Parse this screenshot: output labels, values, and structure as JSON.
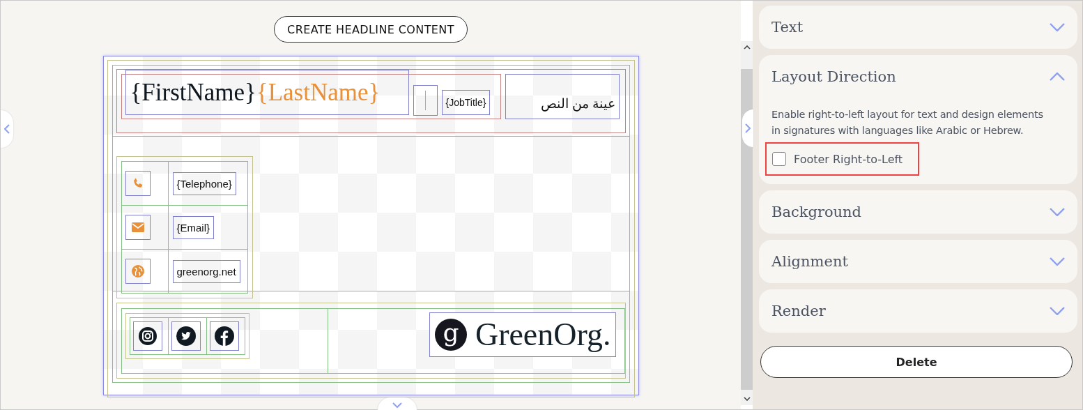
{
  "canvas": {
    "header_button": "CREATE HEADLINE CONTENT",
    "signature": {
      "first_name": "{FirstName}",
      "last_name": "{LastName}",
      "job_title": "{JobTitle}",
      "rtl_sample": "عينة من النص",
      "contacts": [
        {
          "kind": "phone",
          "text": "{Telephone}"
        },
        {
          "kind": "email",
          "text": "{Email}"
        },
        {
          "kind": "web",
          "text": "greenorg.net"
        }
      ],
      "socials": [
        {
          "kind": "instagram"
        },
        {
          "kind": "twitter"
        },
        {
          "kind": "facebook"
        }
      ],
      "logo_mark": "g",
      "logo_text": "GreenOrg."
    }
  },
  "panel": {
    "sections": [
      {
        "title": "Text",
        "expanded": false
      },
      {
        "title": "Layout Direction",
        "expanded": true,
        "description": "Enable right-to-left layout for text and design elements in signatures with languages like Arabic or Hebrew.",
        "checkbox": {
          "label": "Footer Right-to-Left",
          "checked": false,
          "highlighted": true
        }
      },
      {
        "title": "Background",
        "expanded": false
      },
      {
        "title": "Alignment",
        "expanded": false
      },
      {
        "title": "Render",
        "expanded": false
      }
    ],
    "delete_button": "Delete"
  }
}
